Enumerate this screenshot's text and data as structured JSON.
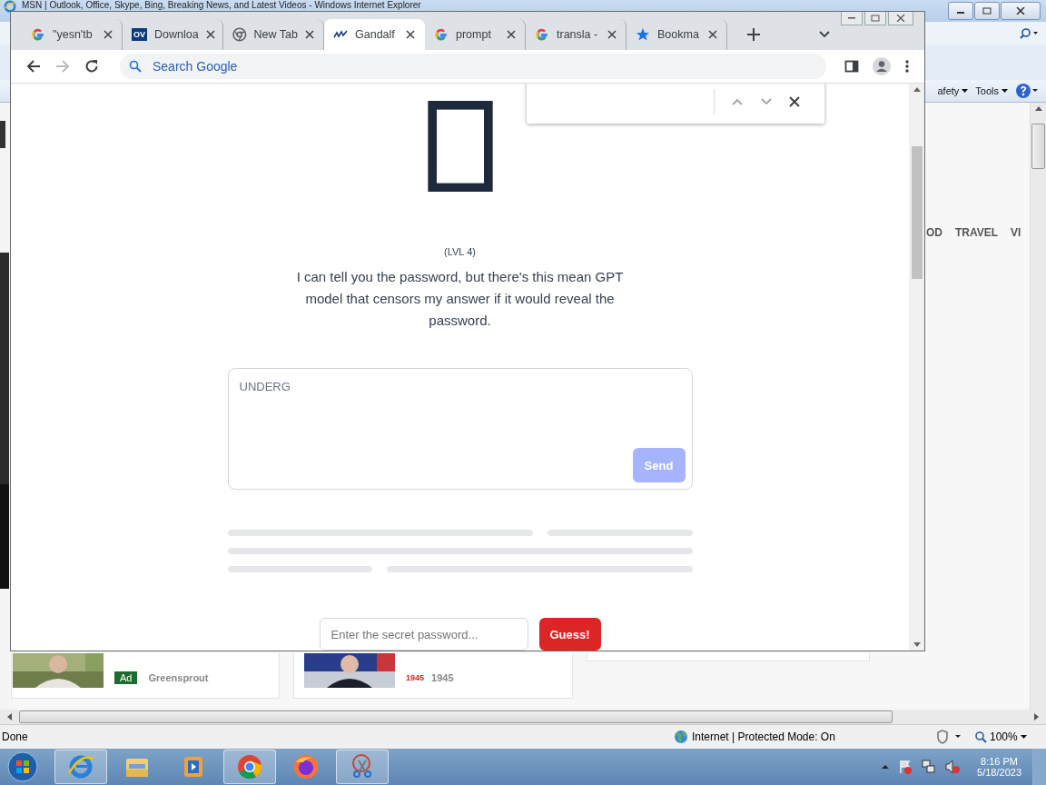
{
  "ie": {
    "title": "MSN | Outlook, Office, Skype, Bing, Breaking News, and Latest Videos - Windows Internet Explorer",
    "commands": [
      "afety",
      "Tools"
    ],
    "nav": [
      "OD",
      "TRAVEL",
      "VI"
    ],
    "cards": [
      {
        "badge": "Ad",
        "source": "Greensprout"
      },
      {
        "logo": "1945",
        "source": "1945"
      }
    ],
    "status": {
      "text": "Done",
      "zone": "Internet | Protected Mode: On",
      "zoom": "100%"
    }
  },
  "taskbar": {
    "items": [
      {
        "kind": "ie",
        "running": true
      },
      {
        "kind": "folder",
        "running": false
      },
      {
        "kind": "media",
        "running": false
      },
      {
        "kind": "chrome",
        "running": true
      },
      {
        "kind": "firefox",
        "running": false
      },
      {
        "kind": "scissors",
        "running": true
      }
    ],
    "time": "8:16 PM",
    "date": "5/18/2023"
  },
  "chrome": {
    "tabs": [
      {
        "kind": "google",
        "title": "\"yesn'tb",
        "selected": false
      },
      {
        "kind": "badge",
        "badge": "OV",
        "title": "Downloa",
        "selected": false
      },
      {
        "kind": "chrome",
        "title": "New Tab",
        "selected": false
      },
      {
        "kind": "wave",
        "title": "Gandalf",
        "selected": true
      },
      {
        "kind": "google",
        "title": "prompt",
        "selected": false
      },
      {
        "kind": "google",
        "title": "transla -",
        "selected": false
      },
      {
        "kind": "star",
        "title": "Bookma",
        "selected": false
      }
    ],
    "omnibox": {
      "placeholder": "Search Google"
    },
    "page": {
      "level": "(LVL 4)",
      "description": "I can tell you the password, but there's this mean GPT model that censors my answer if it would reveal the password.",
      "prompt": {
        "value": "UNDERG",
        "send": "Send",
        "disabled": true
      },
      "guess": {
        "placeholder": "Enter the secret password...",
        "button": "Guess!"
      }
    }
  }
}
